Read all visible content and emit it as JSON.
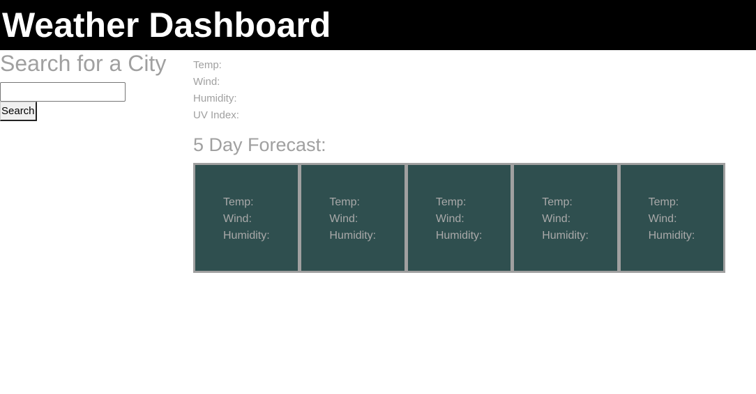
{
  "header": {
    "title": "Weather Dashboard"
  },
  "search": {
    "heading": "Search for a City",
    "input_value": "",
    "placeholder": "",
    "button_label": "Search"
  },
  "current": {
    "temp_label": "Temp:",
    "wind_label": "Wind:",
    "humidity_label": "Humidity:",
    "uv_label": "UV Index:"
  },
  "forecast": {
    "heading": "5 Day Forecast:",
    "days": [
      {
        "temp": "Temp:",
        "wind": "Wind:",
        "humidity": "Humidity:"
      },
      {
        "temp": "Temp:",
        "wind": "Wind:",
        "humidity": "Humidity:"
      },
      {
        "temp": "Temp:",
        "wind": "Wind:",
        "humidity": "Humidity:"
      },
      {
        "temp": "Temp:",
        "wind": "Wind:",
        "humidity": "Humidity:"
      },
      {
        "temp": "Temp:",
        "wind": "Wind:",
        "humidity": "Humidity:"
      }
    ]
  },
  "colors": {
    "header_bg": "#000000",
    "card_bg": "#2f4f4f",
    "muted_text": "#a0a0a0"
  }
}
